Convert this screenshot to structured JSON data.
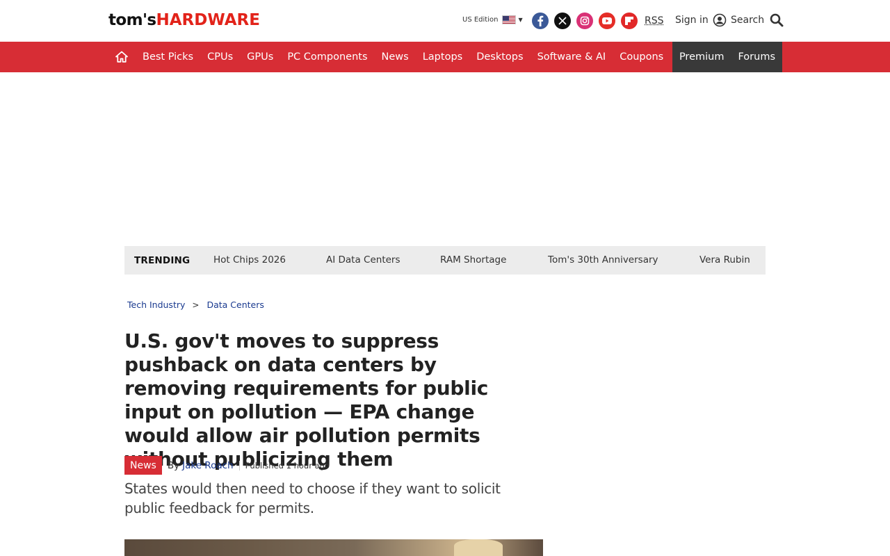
{
  "header": {
    "logo_toms": "tom's",
    "logo_hardware": "HARDWARE",
    "edition": "US Edition",
    "rss": "RSS",
    "signin": "Sign in",
    "search": "Search",
    "socials": [
      "facebook-icon",
      "x-icon",
      "instagram-icon",
      "youtube-icon",
      "flipboard-icon"
    ]
  },
  "nav": {
    "items": [
      "Best Picks",
      "CPUs",
      "GPUs",
      "PC Components",
      "News",
      "Laptops",
      "Desktops",
      "Software & AI",
      "Coupons"
    ],
    "premium": "Premium",
    "forums": "Forums",
    "accent": "#d72d35"
  },
  "trending": {
    "label": "TRENDING",
    "items": [
      "Hot Chips 2026",
      "AI Data Centers",
      "RAM Shortage",
      "Tom's 30th Anniversary",
      "Vera Rubin"
    ]
  },
  "breadcrumb": [
    "Tech Industry",
    "Data Centers"
  ],
  "breadcrumb_sep": ">",
  "article": {
    "title": "U.S. gov't moves to suppress pushback on data centers by removing requirements for public input on pollution — EPA change would allow air pollution permits without publicizing them",
    "tag": "News",
    "by": "By",
    "author": "Jake Roach",
    "published": "Published 1 hour ago",
    "strapline": "States would then need to choose if they want to solicit public feedback for permits."
  }
}
